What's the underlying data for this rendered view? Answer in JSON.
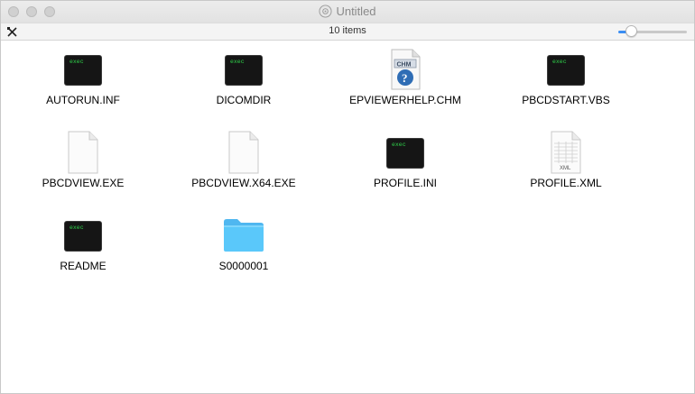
{
  "window": {
    "title": "Untitled",
    "item_count": "10 items"
  },
  "files": [
    {
      "name": "AUTORUN.INF",
      "icon": "exec-icon"
    },
    {
      "name": "DICOMDIR",
      "icon": "exec-icon"
    },
    {
      "name": "EPVIEWERHELP.CHM",
      "icon": "chm-icon"
    },
    {
      "name": "PBCDSTART.VBS",
      "icon": "exec-icon"
    },
    {
      "name": "PBCDVIEW.EXE",
      "icon": "blank-document-icon"
    },
    {
      "name": "PBCDVIEW.X64.EXE",
      "icon": "blank-document-icon"
    },
    {
      "name": "PROFILE.INI",
      "icon": "exec-icon"
    },
    {
      "name": "PROFILE.XML",
      "icon": "xml-document-icon"
    },
    {
      "name": "README",
      "icon": "exec-icon"
    },
    {
      "name": "S0000001",
      "icon": "folder-icon"
    }
  ],
  "icon_labels": {
    "exec": "exec",
    "chm": "CHM",
    "xml": "XML"
  },
  "colors": {
    "folder": "#5ac8fa",
    "exec_text": "#2fd24a",
    "slider_accent": "#3b8ef3"
  }
}
